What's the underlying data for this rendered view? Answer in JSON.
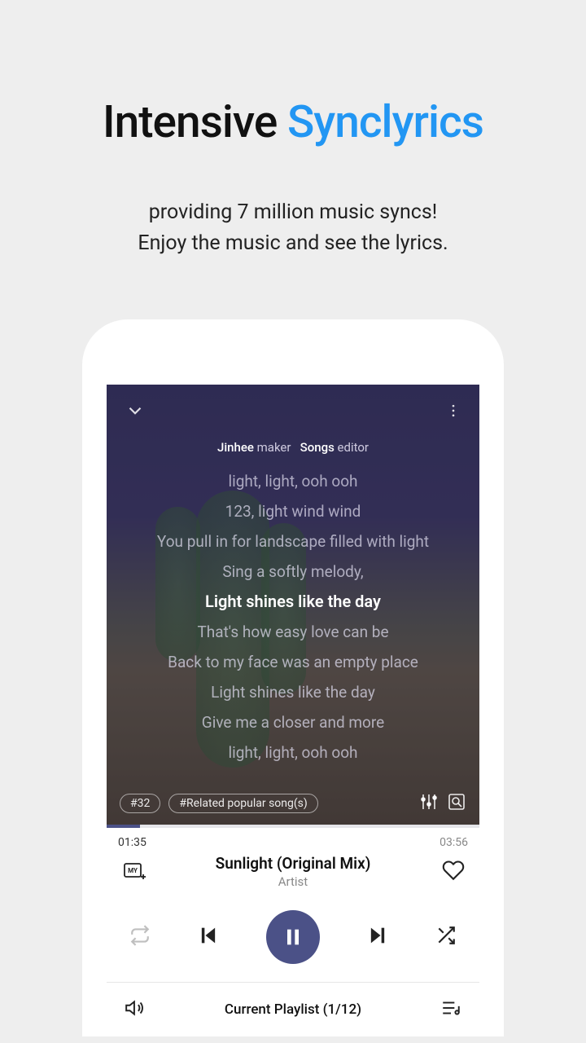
{
  "hero": {
    "title_a": "Intensive ",
    "title_b": "Synclyrics",
    "sub_l1": "providing 7 million music syncs!",
    "sub_l2": "Enjoy the music and see the lyrics."
  },
  "player": {
    "meta": {
      "a_strong": "Jinhee",
      "a_light": "maker",
      "b_strong": "Songs",
      "b_light": "editor"
    },
    "lyrics": [
      "light, light, ooh ooh",
      "123, light wind wind",
      "You pull in for landscape filled with light",
      "Sing a softly melody,",
      "Light shines like the day",
      "That's how easy love can be",
      "Back to my face was an empty place",
      "Light shines like the day",
      "Give me a closer and more",
      "light, light, ooh ooh"
    ],
    "current_index": 4,
    "chip1": "#32",
    "chip2": "#Related popular song(s)",
    "time_elapsed": "01:35",
    "time_total": "03:56",
    "track_title": "Sunlight (Original Mix)",
    "track_artist": "Artist",
    "playlist_label": "Current Playlist (1/12)"
  }
}
